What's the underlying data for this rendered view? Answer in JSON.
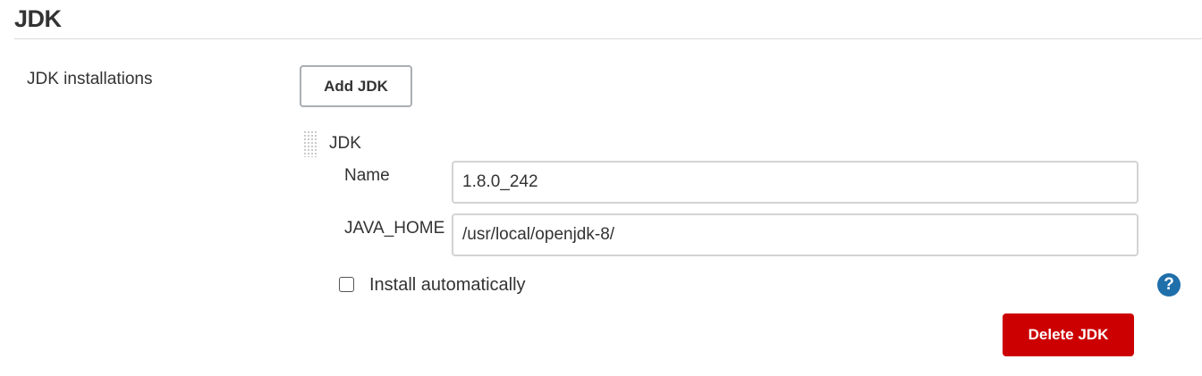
{
  "section": {
    "title": "JDK"
  },
  "installations": {
    "label": "JDK installations",
    "add_button_label": "Add JDK"
  },
  "jdk_block": {
    "title": "JDK",
    "name_label": "Name",
    "name_value": "1.8.0_242",
    "java_home_label": "JAVA_HOME",
    "java_home_value": "/usr/local/openjdk-8/",
    "install_auto_label": "Install automatically",
    "install_auto_checked": false,
    "help_glyph": "?",
    "delete_button_label": "Delete JDK"
  },
  "colors": {
    "delete_button": "#cc0000",
    "help_icon": "#1f6faa"
  },
  "icons": {
    "drag_handle": "drag-handle-icon",
    "help": "help-icon"
  }
}
